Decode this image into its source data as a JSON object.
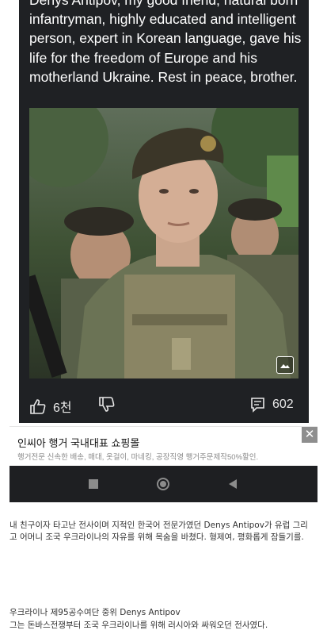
{
  "post": {
    "text": "Denys Antipov, my good friend, natural born infantryman, highly educated and intelligent person, expert in Korean language, gave his life for the freedom of Europe and his motherland Ukraine. Rest in peace, brother."
  },
  "actions": {
    "likes": "6천",
    "comments": "602"
  },
  "ad": {
    "title": "인씨아 행거 국내대표 쇼핑몰",
    "subtitle": "행거전문 신속한 배송, 매대, 옷걸이, 마네킹, 공장직영 행거주문제작50%할인.",
    "close": "✕"
  },
  "caption": {
    "p1": "내 친구이자 타고난 전사이며 지적인 한국어 전문가였던 Denys Antipov가 유럽 그리고 어머니 조국 우크라이나의 자유를 위해 목숨을 바쳤다. 형제여, 평화롭게 잠들기를.",
    "p2_line1": "우크라이나 제95공수여단 중위 Denys Antipov",
    "p2_line2": "그는 돈바스전쟁부터 조국 우크라이나를 위해 러시아와 싸워오던 전사였다."
  },
  "colors": {
    "panel": "#1f2124",
    "ad_sub": "#8a8a8a",
    "nav": "#1e1f22"
  }
}
